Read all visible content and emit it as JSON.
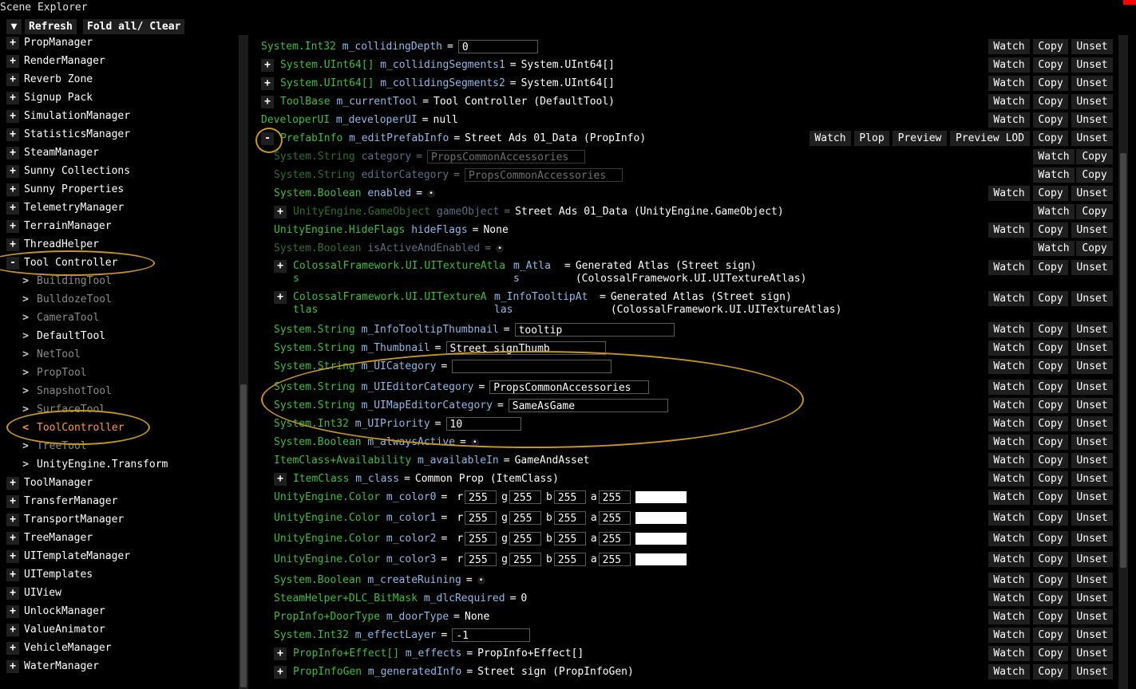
{
  "window": {
    "title": "Scene Explorer"
  },
  "toolbar": {
    "fold_icon": "▼",
    "refresh": "Refresh",
    "fold_clear": "Fold all/ Clear"
  },
  "tree": [
    {
      "label": "PropManager",
      "kind": "plus",
      "style": "white"
    },
    {
      "label": "RenderManager",
      "kind": "plus",
      "style": "white"
    },
    {
      "label": "Reverb Zone",
      "kind": "plus",
      "style": "white"
    },
    {
      "label": "Signup Pack",
      "kind": "plus",
      "style": "white"
    },
    {
      "label": "SimulationManager",
      "kind": "plus",
      "style": "white"
    },
    {
      "label": "StatisticsManager",
      "kind": "plus",
      "style": "white"
    },
    {
      "label": "SteamManager",
      "kind": "plus",
      "style": "white"
    },
    {
      "label": "Sunny Collections",
      "kind": "plus",
      "style": "white"
    },
    {
      "label": "Sunny Properties",
      "kind": "plus",
      "style": "white"
    },
    {
      "label": "TelemetryManager",
      "kind": "plus",
      "style": "white"
    },
    {
      "label": "TerrainManager",
      "kind": "plus",
      "style": "white"
    },
    {
      "label": "ThreadHelper",
      "kind": "plus",
      "style": "white"
    },
    {
      "label": "Tool Controller",
      "kind": "minus",
      "style": "white"
    },
    {
      "label": "BuildingTool",
      "kind": "arrow",
      "style": "dim"
    },
    {
      "label": "BulldozeTool",
      "kind": "arrow",
      "style": "dim"
    },
    {
      "label": "CameraTool",
      "kind": "arrow",
      "style": "dim"
    },
    {
      "label": "DefaultTool",
      "kind": "arrow",
      "style": "white"
    },
    {
      "label": "NetTool",
      "kind": "arrow",
      "style": "dim"
    },
    {
      "label": "PropTool",
      "kind": "arrow",
      "style": "dim"
    },
    {
      "label": "SnapshotTool",
      "kind": "arrow",
      "style": "dim"
    },
    {
      "label": "SurfaceTool",
      "kind": "arrow",
      "style": "dim"
    },
    {
      "label": "ToolController",
      "kind": "arrow-open",
      "style": "orange"
    },
    {
      "label": "TreeTool",
      "kind": "arrow",
      "style": "dim"
    },
    {
      "label": "UnityEngine.Transform",
      "kind": "arrow",
      "style": "white"
    },
    {
      "label": "ToolManager",
      "kind": "plus",
      "style": "white"
    },
    {
      "label": "TransferManager",
      "kind": "plus",
      "style": "white"
    },
    {
      "label": "TransportManager",
      "kind": "plus",
      "style": "white"
    },
    {
      "label": "TreeManager",
      "kind": "plus",
      "style": "white"
    },
    {
      "label": "UITemplateManager",
      "kind": "plus",
      "style": "white"
    },
    {
      "label": "UITemplates",
      "kind": "plus",
      "style": "white"
    },
    {
      "label": "UIView",
      "kind": "plus",
      "style": "white"
    },
    {
      "label": "UnlockManager",
      "kind": "plus",
      "style": "white"
    },
    {
      "label": "ValueAnimator",
      "kind": "plus",
      "style": "white"
    },
    {
      "label": "VehicleManager",
      "kind": "plus",
      "style": "white"
    },
    {
      "label": "WaterManager",
      "kind": "plus",
      "style": "white"
    }
  ],
  "symbols": {
    "plus": "+",
    "minus": "-",
    "arrow": ">",
    "arrow_open": "<",
    "equals": "=",
    "checkbox": "•"
  },
  "actions": {
    "watch": "Watch",
    "copy": "Copy",
    "unset": "Unset",
    "plop": "Plop",
    "preview": "Preview",
    "preview_lod": "Preview LOD"
  },
  "props": [
    {
      "type": "System.Int32",
      "name": "m_collidingDepth",
      "input": "0"
    },
    {
      "type": "System.UInt64[]",
      "name": "m_collidingSegments1",
      "value": "System.UInt64[]"
    },
    {
      "type": "System.UInt64[]",
      "name": "m_collidingSegments2",
      "value": "System.UInt64[]"
    },
    {
      "type": "ToolBase",
      "name": "m_currentTool",
      "value": "Tool Controller (DefaultTool)"
    },
    {
      "type": "DeveloperUI",
      "name": "m_developerUI",
      "value": "null"
    },
    {
      "type": "PrefabInfo",
      "name": "m_editPrefabInfo",
      "value": "Street Ads 01_Data (PropInfo)"
    },
    {
      "type": "System.String",
      "name": "category",
      "input": "PropsCommonAccessories"
    },
    {
      "type": "System.String",
      "name": "editorCategory",
      "input": "PropsCommonAccessories"
    },
    {
      "type": "System.Boolean",
      "name": "enabled"
    },
    {
      "type": "UnityEngine.GameObject",
      "name": "gameObject",
      "value": "Street Ads 01_Data (UnityEngine.GameObject)"
    },
    {
      "type": "UnityEngine.HideFlags",
      "name": "hideFlags",
      "value": "None"
    },
    {
      "type": "System.Boolean",
      "name": "isActiveAndEnabled"
    },
    {
      "type1": "ColossalFramework.UI.UITextureAtla",
      "type2": "s",
      "name1": "m_Atla",
      "name2": "s",
      "value1": "Generated Atlas (Street sign)",
      "value2": "(ColossalFramework.UI.UITextureAtlas)"
    },
    {
      "type1": "ColossalFramework.UI.UITextureA",
      "type2": "tlas",
      "name1": "m_InfoTooltipAt",
      "name2": "las",
      "value1": "Generated Atlas (Street sign)",
      "value2": "(ColossalFramework.UI.UITextureAtlas)"
    },
    {
      "type": "System.String",
      "name": "m_InfoTooltipThumbnail",
      "input": "tooltip"
    },
    {
      "type": "System.String",
      "name": "m_Thumbnail",
      "input": "Street signThumb"
    },
    {
      "type": "System.String",
      "name": "m_UICategory",
      "input": ""
    },
    {
      "type": "System.String",
      "name": "m_UIEditorCategory",
      "input": "PropsCommonAccessories"
    },
    {
      "type": "System.String",
      "name": "m_UIMapEditorCategory",
      "input": "SameAsGame"
    },
    {
      "type": "System.Int32",
      "name": "m_UIPriority",
      "input": "10"
    },
    {
      "type": "System.Boolean",
      "name": "m_alwaysActive"
    },
    {
      "type": "ItemClass+Availability",
      "name": "m_availableIn",
      "value": "GameAndAsset"
    },
    {
      "type": "ItemClass",
      "name": "m_class",
      "value": "Common Prop (ItemClass)"
    },
    {
      "type": "UnityEngine.Color",
      "name": "m_color0",
      "r": "255",
      "g": "255",
      "b": "255",
      "a": "255"
    },
    {
      "type": "UnityEngine.Color",
      "name": "m_color1",
      "r": "255",
      "g": "255",
      "b": "255",
      "a": "255"
    },
    {
      "type": "UnityEngine.Color",
      "name": "m_color2",
      "r": "255",
      "g": "255",
      "b": "255",
      "a": "255"
    },
    {
      "type": "UnityEngine.Color",
      "name": "m_color3",
      "r": "255",
      "g": "255",
      "b": "255",
      "a": "255"
    },
    {
      "type": "System.Boolean",
      "name": "m_createRuining"
    },
    {
      "type": "SteamHelper+DLC_BitMask",
      "name": "m_dlcRequired",
      "value": "0"
    },
    {
      "type": "PropInfo+DoorType",
      "name": "m_doorType",
      "value": "None"
    },
    {
      "type": "System.Int32",
      "name": "m_effectLayer",
      "input": "-1"
    },
    {
      "type": "PropInfo+Effect[]",
      "name": "m_effects",
      "value": "PropInfo+Effect[]"
    },
    {
      "type": "PropInfoGen",
      "name": "m_generatedInfo",
      "value": "Street sign (PropInfoGen)"
    }
  ],
  "color_labels": {
    "r": "r",
    "g": "g",
    "b": "b",
    "a": "a"
  },
  "colors": {
    "bg": "#000000",
    "type_green": "#3bbf3b",
    "name_blue": "#8fb8e8",
    "button_bg": "#1f1f1f",
    "highlight_orange": "#ff9a2e",
    "annotation_ring": "#c7961a",
    "close_red": "#ff0000"
  }
}
